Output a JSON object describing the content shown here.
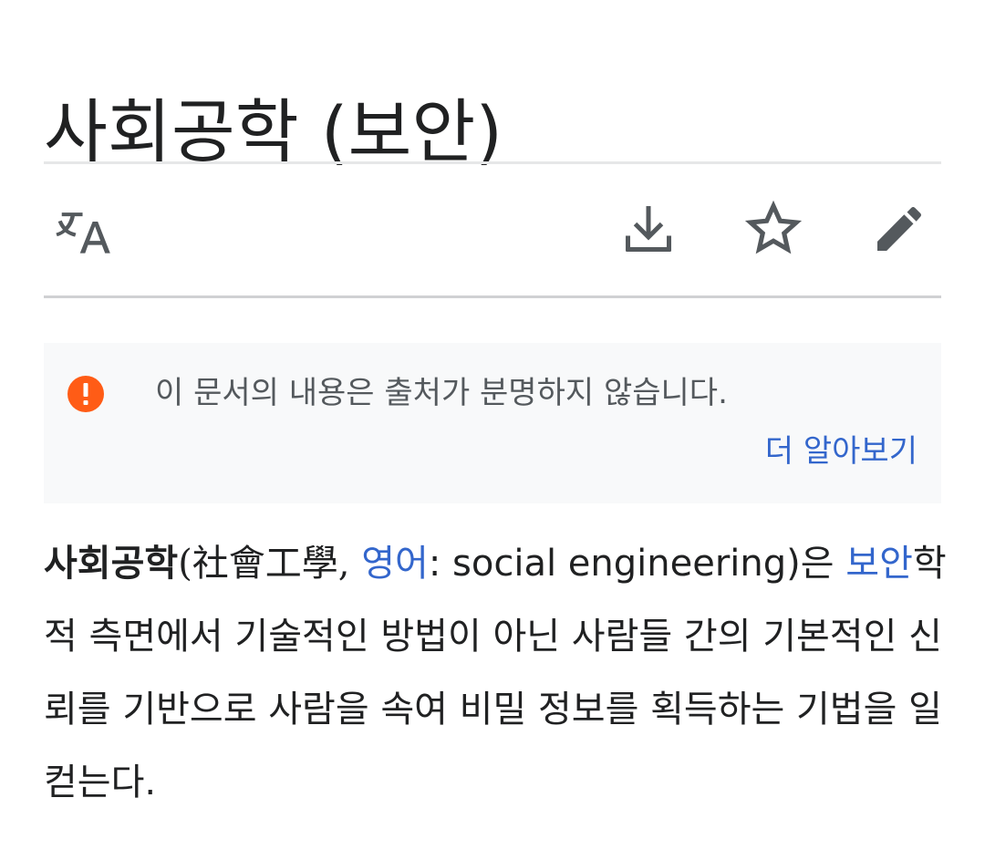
{
  "page": {
    "title": "사회공학 (보안)"
  },
  "toolbar": {
    "language_icon": "translate-icon",
    "download_icon": "download-icon",
    "watch_icon": "star-icon",
    "edit_icon": "pencil-icon",
    "icon_color": "#54595d"
  },
  "notice": {
    "icon": "exclamation-circle-icon",
    "icon_color": "#ff5c16",
    "text": "이 문서의 내용은 출처가 분명하지 않습니다.",
    "learn_more": "더 알아보기"
  },
  "article": {
    "term": "사회공학",
    "hanja": "(社會工學, ",
    "lang_link": "영어",
    "english": ": social engineering)은 ",
    "security_link": "보안",
    "body": "학적 측면에서 기술적인 방법이 아닌 사람들 간의 기본적인 신뢰를 기반으로 사람을 속여 비밀 정보를 획득하는 기법을 일컫는다."
  },
  "colors": {
    "text": "#202122",
    "link": "#3366cc",
    "notice_bg": "#f8f9fa",
    "divider": "#e6e7e8"
  }
}
